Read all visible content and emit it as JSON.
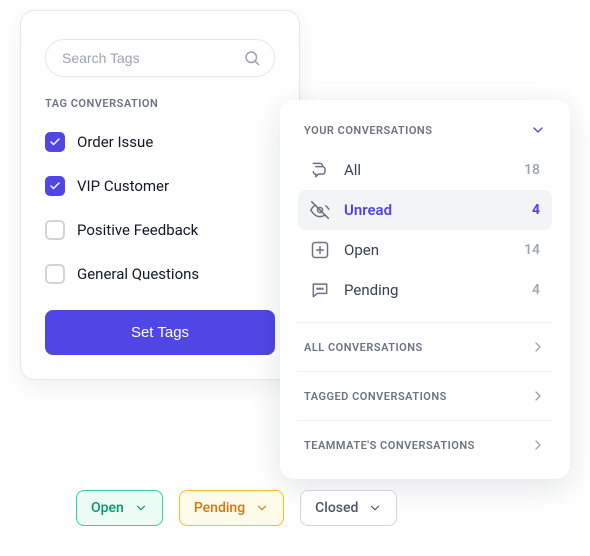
{
  "tagPanel": {
    "searchPlaceholder": "Search Tags",
    "sectionLabel": "TAG CONVERSATION",
    "tags": [
      {
        "label": "Order Issue",
        "checked": true
      },
      {
        "label": "VIP Customer",
        "checked": true
      },
      {
        "label": "Positive Feedback",
        "checked": false
      },
      {
        "label": "General Questions",
        "checked": false
      }
    ],
    "buttonLabel": "Set Tags"
  },
  "convPanel": {
    "headerLabel": "YOUR CONVERSATIONS",
    "items": [
      {
        "icon": "chat-icon",
        "name": "All",
        "count": 18,
        "active": false
      },
      {
        "icon": "eye-off-icon",
        "name": "Unread",
        "count": 4,
        "active": true
      },
      {
        "icon": "plus-square-icon",
        "name": "Open",
        "count": 14,
        "active": false
      },
      {
        "icon": "message-dots-icon",
        "name": "Pending",
        "count": 4,
        "active": false
      }
    ],
    "groups": [
      {
        "label": "ALL CONVERSATIONS"
      },
      {
        "label": "TAGGED CONVERSATIONS"
      },
      {
        "label": "TEAMMATE'S CONVERSATIONS"
      }
    ]
  },
  "statuses": [
    {
      "label": "Open",
      "variant": "open"
    },
    {
      "label": "Pending",
      "variant": "pending"
    },
    {
      "label": "Closed",
      "variant": "closed"
    }
  ]
}
